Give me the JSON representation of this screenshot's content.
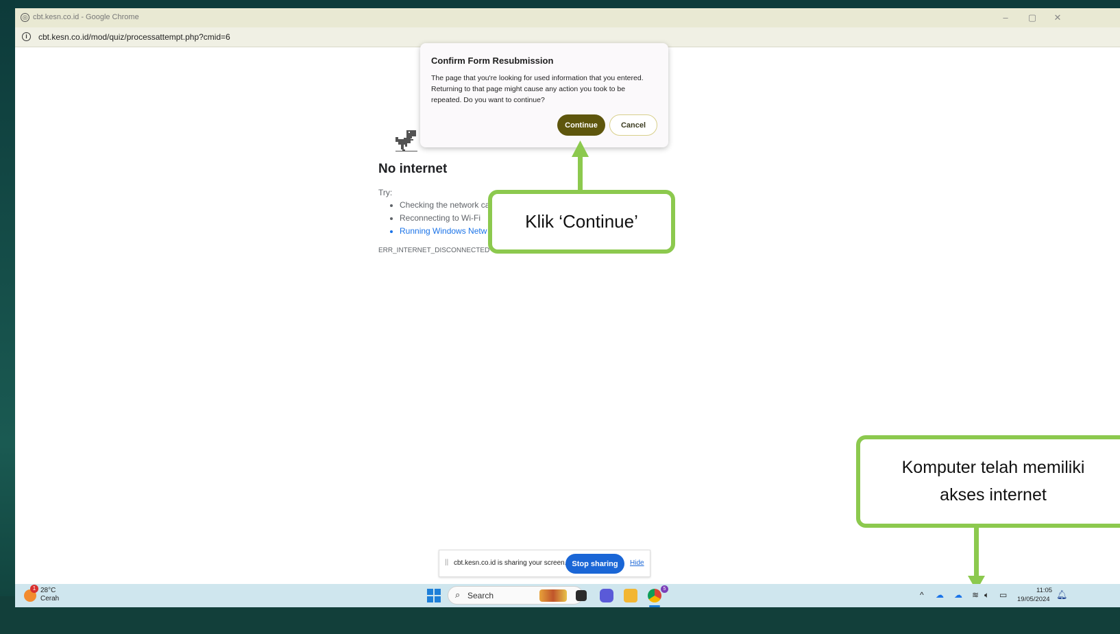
{
  "window": {
    "title": "cbt.kesn.co.id - Google Chrome",
    "url": "cbt.kesn.co.id/mod/quiz/processattempt.php?cmid=6",
    "controls": {
      "minimize": "–",
      "maximize": "▢",
      "close": "✕"
    }
  },
  "error_page": {
    "heading": "No internet",
    "try_label": "Try:",
    "suggestions": [
      "Checking the network ca",
      "Reconnecting to Wi-Fi",
      "Running Windows Netw"
    ],
    "error_code": "ERR_INTERNET_DISCONNECTED"
  },
  "dialog": {
    "title": "Confirm Form Resubmission",
    "body": "The page that you're looking for used information that you entered. Returning to that page might cause any action you took to be repeated. Do you want to continue?",
    "continue_label": "Continue",
    "cancel_label": "Cancel"
  },
  "annotations": {
    "continue_callout": "Klik ‘Continue’",
    "internet_callout_line1": "Komputer telah memiliki",
    "internet_callout_line2": "akses internet"
  },
  "share_bar": {
    "text": "cbt.kesn.co.id is sharing your screen.",
    "stop_label": "Stop sharing",
    "hide_label": "Hide"
  },
  "taskbar": {
    "weather_badge": "1",
    "temperature": "28°C",
    "condition": "Cerah",
    "search_placeholder": "Search",
    "chrome_badge": "5",
    "time": "11:05",
    "date": "19/05/2024"
  },
  "colors": {
    "callout_border": "#8cc94e",
    "continue_button": "#5e560d",
    "stop_sharing_button": "#1a66d6"
  }
}
